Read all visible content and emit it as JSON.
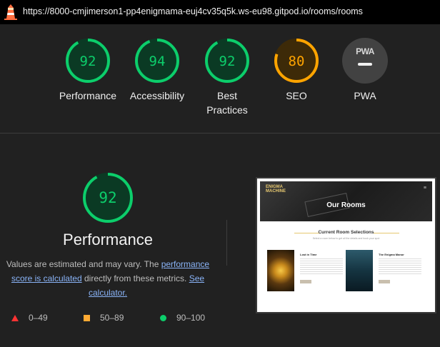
{
  "url": "https://8000-cmjimerson1-pp4enigmama-euj4cv35q5k.ws-eu98.gitpod.io/rooms/rooms",
  "colors": {
    "pass": "#0cce6b",
    "average": "#ffa400",
    "fail": "#ff3333",
    "pwa_bg": "#424242"
  },
  "scores": [
    {
      "label": "Performance",
      "value": "92",
      "status": "pass"
    },
    {
      "label": "Accessibility",
      "value": "94",
      "status": "pass"
    },
    {
      "label": "Best Practices",
      "value": "92",
      "status": "pass"
    },
    {
      "label": "SEO",
      "value": "80",
      "status": "average"
    }
  ],
  "pwa": {
    "label": "PWA",
    "badge": "PWA",
    "icon": "dash-icon"
  },
  "main": {
    "score": "92",
    "title": "Performance",
    "desc_pre": "Values are estimated and may vary. The ",
    "link1": "performance score is calculated",
    "desc_mid": " directly from these metrics. ",
    "link2": "See calculator."
  },
  "legend": [
    {
      "range": "0–49",
      "icon": "triangle-icon"
    },
    {
      "range": "50–89",
      "icon": "square-icon"
    },
    {
      "range": "90–100",
      "icon": "circle-icon"
    }
  ],
  "thumbnail": {
    "logo_line1": "ENIGMA",
    "logo_line2": "MACHINE",
    "hero_title": "Our Rooms",
    "section_title": "Current Room Selections",
    "section_sub": "Select a room below to get all the details and book your spot",
    "card1_title": "Lost in Time",
    "card2_title": "The Enigma Manor"
  }
}
